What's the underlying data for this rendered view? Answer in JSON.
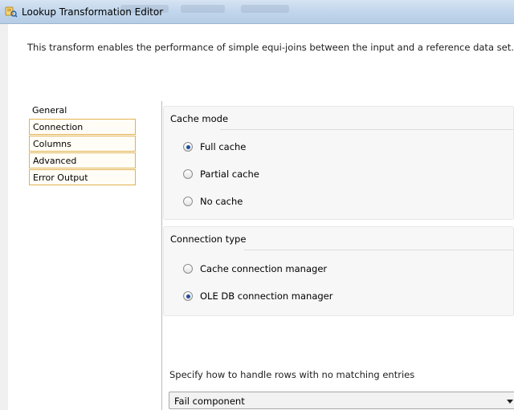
{
  "window": {
    "title": "Lookup Transformation Editor"
  },
  "header": {
    "description": "This transform enables the performance of simple equi-joins between the input and a reference data set."
  },
  "nav": {
    "items": [
      {
        "label": "General",
        "boxed": false
      },
      {
        "label": "Connection",
        "boxed": true
      },
      {
        "label": "Columns",
        "boxed": true
      },
      {
        "label": "Advanced",
        "boxed": true
      },
      {
        "label": "Error Output",
        "boxed": true
      }
    ]
  },
  "cache_mode": {
    "title": "Cache mode",
    "options": [
      {
        "label": "Full cache",
        "checked": true
      },
      {
        "label": "Partial cache",
        "checked": false
      },
      {
        "label": "No cache",
        "checked": false
      }
    ]
  },
  "connection_type": {
    "title": "Connection type",
    "options": [
      {
        "label": "Cache connection manager",
        "checked": false
      },
      {
        "label": "OLE DB connection manager",
        "checked": true
      }
    ]
  },
  "no_match": {
    "instruction": "Specify how to handle rows with no matching entries",
    "selected_value": "Fail component"
  },
  "colors": {
    "nav_box_border": "#e2b250",
    "radio_dot": "#1f4f9c",
    "titlebar": "#c3d7ec"
  }
}
